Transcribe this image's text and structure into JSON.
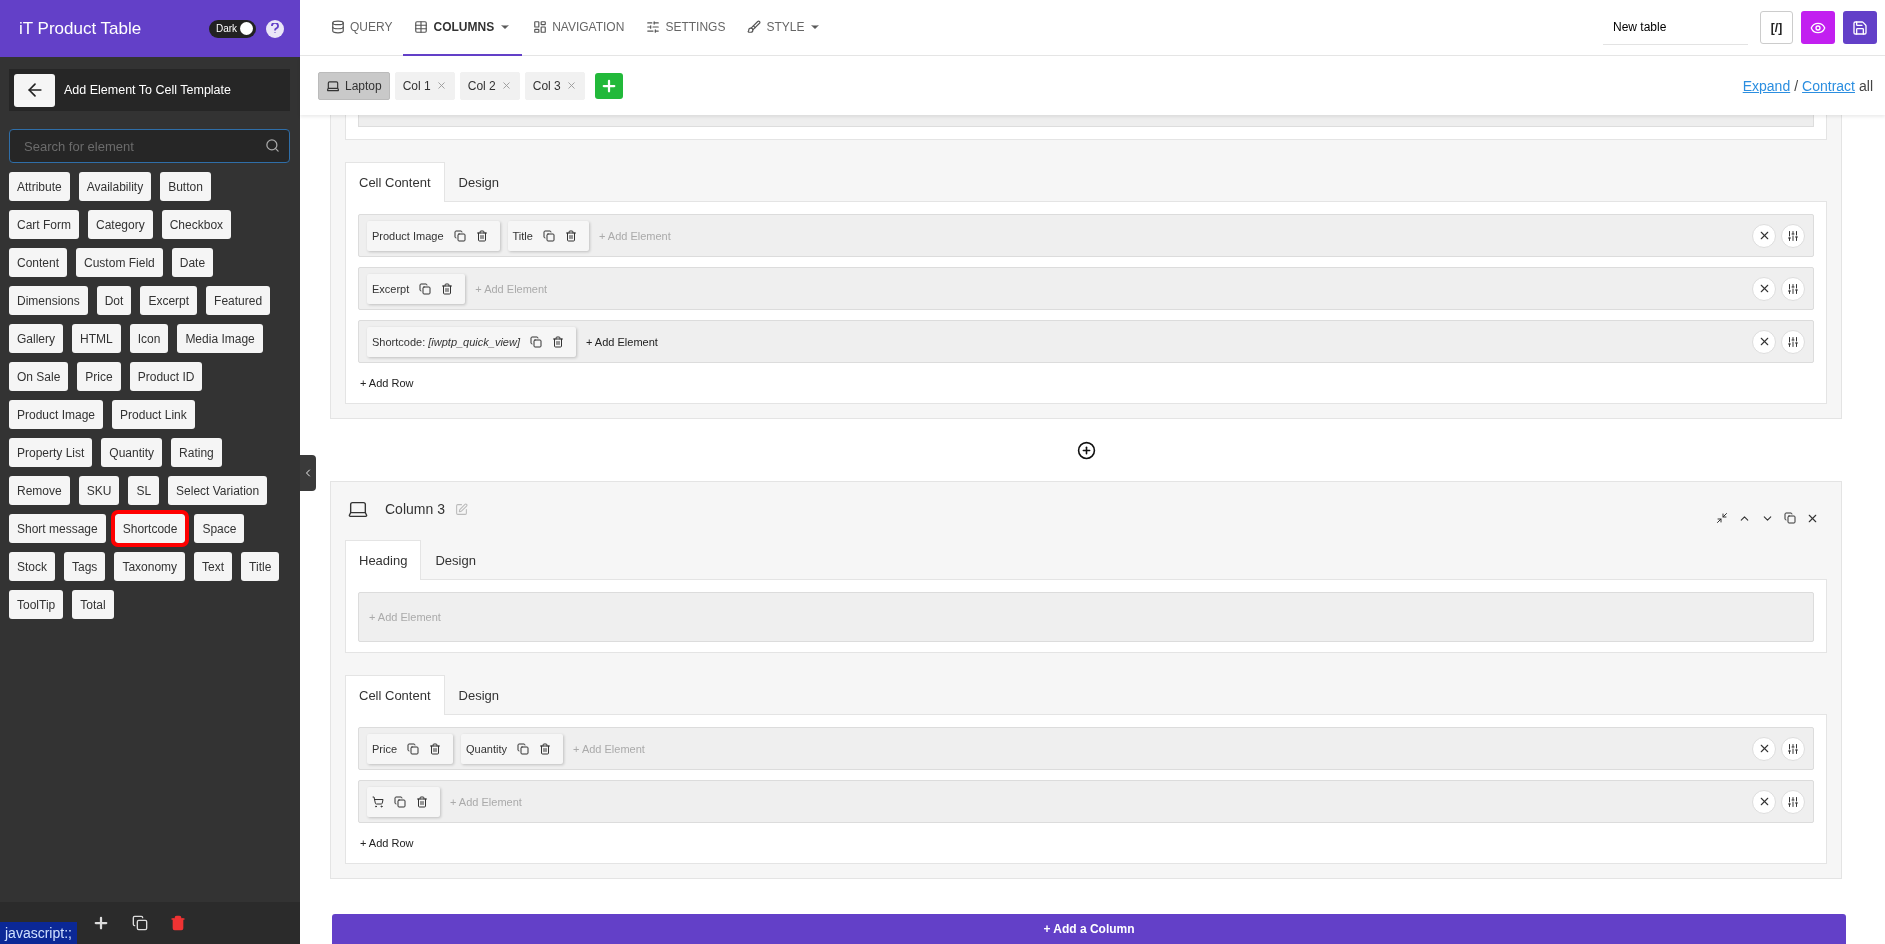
{
  "sidebar": {
    "app_title": "iT Product Table",
    "dark_toggle": {
      "label": "Dark",
      "on": true
    },
    "panel_title": "Add Element To Cell Template",
    "search": {
      "placeholder": "Search for element"
    },
    "elements": [
      {
        "label": "Attribute",
        "highlighted": false
      },
      {
        "label": "Availability",
        "highlighted": false
      },
      {
        "label": "Button",
        "highlighted": false
      },
      {
        "label": "Cart Form",
        "highlighted": false
      },
      {
        "label": "Category",
        "highlighted": false
      },
      {
        "label": "Checkbox",
        "highlighted": false
      },
      {
        "label": "Content",
        "highlighted": false
      },
      {
        "label": "Custom Field",
        "highlighted": false
      },
      {
        "label": "Date",
        "highlighted": false
      },
      {
        "label": "Dimensions",
        "highlighted": false
      },
      {
        "label": "Dot",
        "highlighted": false
      },
      {
        "label": "Excerpt",
        "highlighted": false
      },
      {
        "label": "Featured",
        "highlighted": false
      },
      {
        "label": "Gallery",
        "highlighted": false
      },
      {
        "label": "HTML",
        "highlighted": false
      },
      {
        "label": "Icon",
        "highlighted": false
      },
      {
        "label": "Media Image",
        "highlighted": false
      },
      {
        "label": "On Sale",
        "highlighted": false
      },
      {
        "label": "Price",
        "highlighted": false
      },
      {
        "label": "Product ID",
        "highlighted": false
      },
      {
        "label": "Product Image",
        "highlighted": false
      },
      {
        "label": "Product Link",
        "highlighted": false
      },
      {
        "label": "Property List",
        "highlighted": false
      },
      {
        "label": "Quantity",
        "highlighted": false
      },
      {
        "label": "Rating",
        "highlighted": false
      },
      {
        "label": "Remove",
        "highlighted": false
      },
      {
        "label": "SKU",
        "highlighted": false
      },
      {
        "label": "SL",
        "highlighted": false
      },
      {
        "label": "Select Variation",
        "highlighted": false
      },
      {
        "label": "Short message",
        "highlighted": false
      },
      {
        "label": "Shortcode",
        "highlighted": true
      },
      {
        "label": "Space",
        "highlighted": false
      },
      {
        "label": "Stock",
        "highlighted": false
      },
      {
        "label": "Tags",
        "highlighted": false
      },
      {
        "label": "Taxonomy",
        "highlighted": false
      },
      {
        "label": "Text",
        "highlighted": false
      },
      {
        "label": "Title",
        "highlighted": false
      },
      {
        "label": "ToolTip",
        "highlighted": false
      },
      {
        "label": "Total",
        "highlighted": false
      }
    ],
    "status_link": "javascript:;"
  },
  "nav": {
    "tabs": [
      {
        "label": "QUERY",
        "selected": false,
        "dropdown": false
      },
      {
        "label": "COLUMNS",
        "selected": true,
        "dropdown": true
      },
      {
        "label": "NAVIGATION",
        "selected": false,
        "dropdown": false
      },
      {
        "label": "SETTINGS",
        "selected": false,
        "dropdown": false
      },
      {
        "label": "STYLE",
        "selected": false,
        "dropdown": true
      }
    ],
    "table_name": "New table",
    "code_button": "[/]"
  },
  "devices": {
    "tabs": [
      {
        "label": "Laptop",
        "kind": "device",
        "selected": true
      },
      {
        "label": "Col 1",
        "kind": "column",
        "selected": false
      },
      {
        "label": "Col 2",
        "kind": "column",
        "selected": false
      },
      {
        "label": "Col 3",
        "kind": "column",
        "selected": false
      }
    ],
    "expand": "Expand",
    "separator": "/",
    "contract": "Contract",
    "all": "all"
  },
  "columns": [
    {
      "sections": [
        {
          "kind": "stub"
        },
        {
          "kind": "panel",
          "tabs": [
            {
              "label": "Cell Content",
              "selected": true
            },
            {
              "label": "Design",
              "selected": false
            }
          ],
          "rows": [
            {
              "controls": true,
              "elements": [
                {
                  "kind": "text",
                  "label": "Product Image"
                },
                {
                  "kind": "text",
                  "label": "Title"
                }
              ],
              "add_element": {
                "label": "+ Add Element",
                "active": false
              }
            },
            {
              "controls": true,
              "elements": [
                {
                  "kind": "text",
                  "label": "Excerpt"
                }
              ],
              "add_element": {
                "label": "+ Add Element",
                "active": false
              }
            },
            {
              "controls": true,
              "elements": [
                {
                  "kind": "text",
                  "label": "Shortcode: *[iwptp_quick_view]*"
                }
              ],
              "add_element": {
                "label": "+ Add Element",
                "active": true
              }
            }
          ],
          "add_row": "+ Add Row"
        }
      ]
    },
    {
      "title": "Column 3",
      "sections": [
        {
          "kind": "panel",
          "tabs": [
            {
              "label": "Heading",
              "selected": true
            },
            {
              "label": "Design",
              "selected": false
            }
          ],
          "rows": [
            {
              "controls": false,
              "elements": [],
              "add_element": {
                "label": "+ Add Element",
                "active": false
              }
            }
          ]
        },
        {
          "kind": "panel",
          "tabs": [
            {
              "label": "Cell Content",
              "selected": true
            },
            {
              "label": "Design",
              "selected": false
            }
          ],
          "rows": [
            {
              "controls": true,
              "elements": [
                {
                  "kind": "text",
                  "label": "Price"
                },
                {
                  "kind": "text",
                  "label": "Quantity"
                }
              ],
              "add_element": {
                "label": "+ Add Element",
                "active": false
              }
            },
            {
              "controls": true,
              "elements": [
                {
                  "kind": "cart"
                }
              ],
              "add_element": {
                "label": "+ Add Element",
                "active": false
              }
            }
          ],
          "add_row": "+ Add Row"
        }
      ]
    }
  ],
  "add_column": "+ Add a Column"
}
